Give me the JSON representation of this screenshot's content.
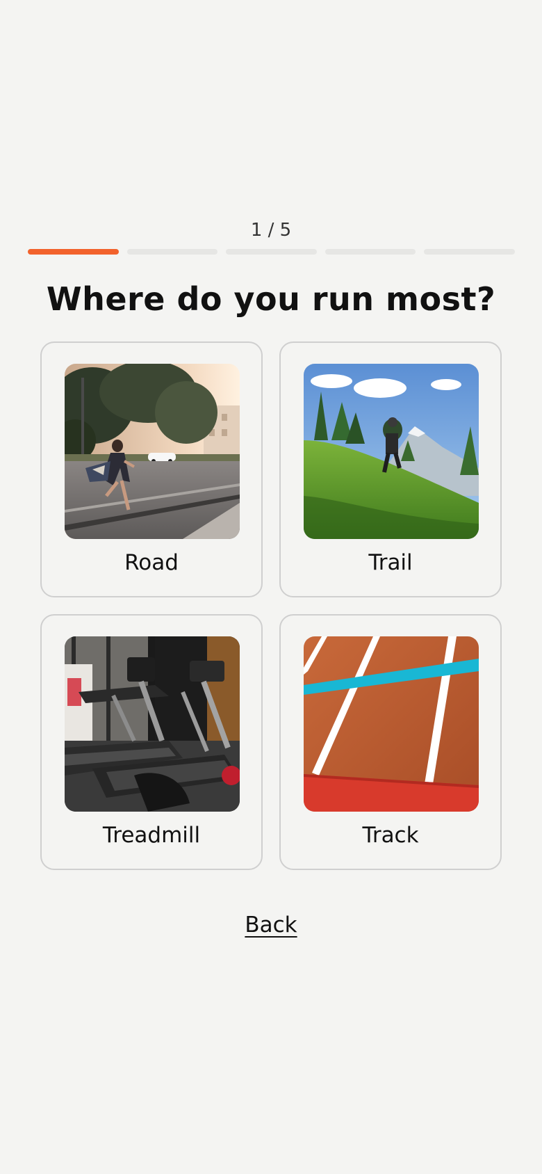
{
  "progress": {
    "counter_text": "1 / 5",
    "current_step": 1,
    "total_steps": 5,
    "active_color": "#f2622c",
    "inactive_color": "#e6e6e4"
  },
  "question": {
    "title": "Where do you run most?"
  },
  "options": [
    {
      "label": "Road",
      "image_icon": "road-photo"
    },
    {
      "label": "Trail",
      "image_icon": "trail-photo"
    },
    {
      "label": "Treadmill",
      "image_icon": "treadmill-photo"
    },
    {
      "label": "Track",
      "image_icon": "track-photo"
    }
  ],
  "navigation": {
    "back_label": "Back"
  }
}
